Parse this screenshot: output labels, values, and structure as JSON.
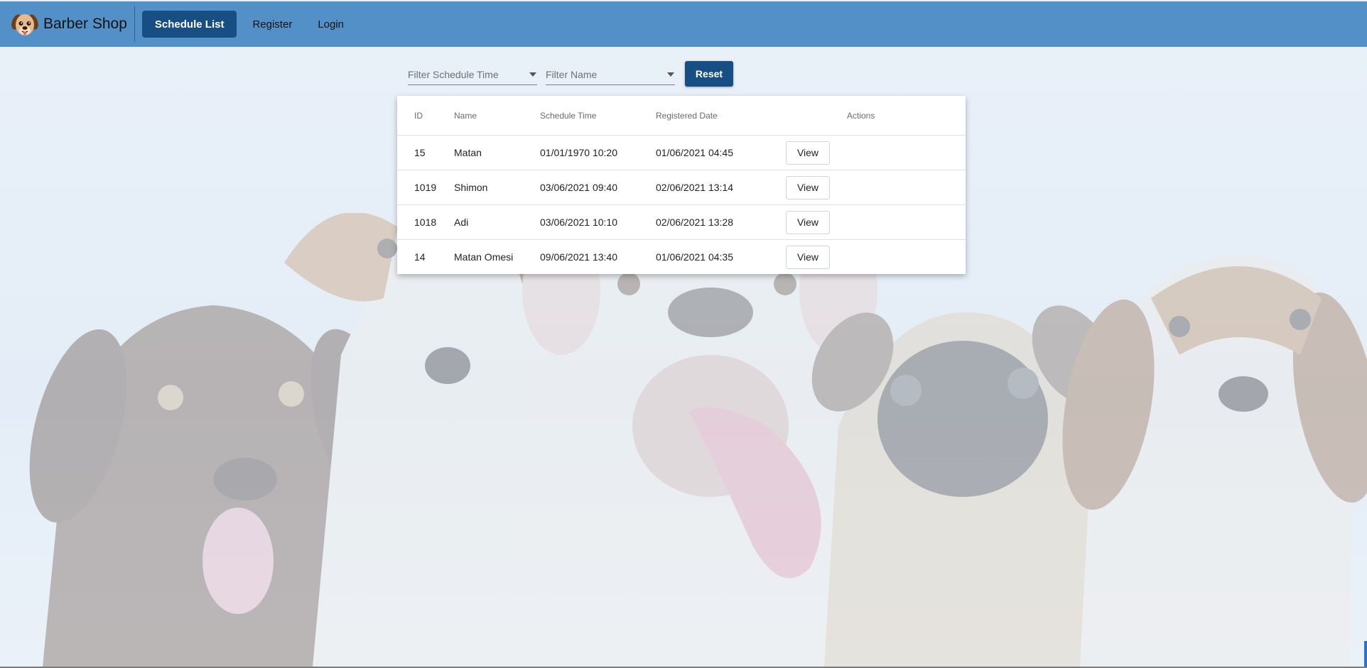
{
  "header": {
    "brand": "Barber Shop",
    "nav": [
      {
        "label": "Schedule List",
        "active": true
      },
      {
        "label": "Register",
        "active": false
      },
      {
        "label": "Login",
        "active": false
      }
    ]
  },
  "filters": {
    "schedule_time_placeholder": "Filter Schedule Time",
    "name_placeholder": "Filter Name",
    "reset_label": "Reset"
  },
  "table": {
    "columns": [
      "ID",
      "Name",
      "Schedule Time",
      "Registered Date",
      "Actions"
    ],
    "rows": [
      {
        "id": "15",
        "name": "Matan",
        "schedule": "01/01/1970 10:20",
        "registered": "01/06/2021 04:45",
        "action": "View"
      },
      {
        "id": "1019",
        "name": "Shimon",
        "schedule": "03/06/2021 09:40",
        "registered": "02/06/2021 13:14",
        "action": "View"
      },
      {
        "id": "1018",
        "name": "Adi",
        "schedule": "03/06/2021 10:10",
        "registered": "02/06/2021 13:28",
        "action": "View"
      },
      {
        "id": "14",
        "name": "Matan Omesi",
        "schedule": "09/06/2021 13:40",
        "registered": "01/06/2021 04:35",
        "action": "View"
      }
    ]
  },
  "colors": {
    "navbar": "#5490c8",
    "primary": "#174f85",
    "background": "#e9f0f8"
  },
  "icons": {
    "brand": "dog-face-icon",
    "dropdown": "caret-down-icon"
  }
}
